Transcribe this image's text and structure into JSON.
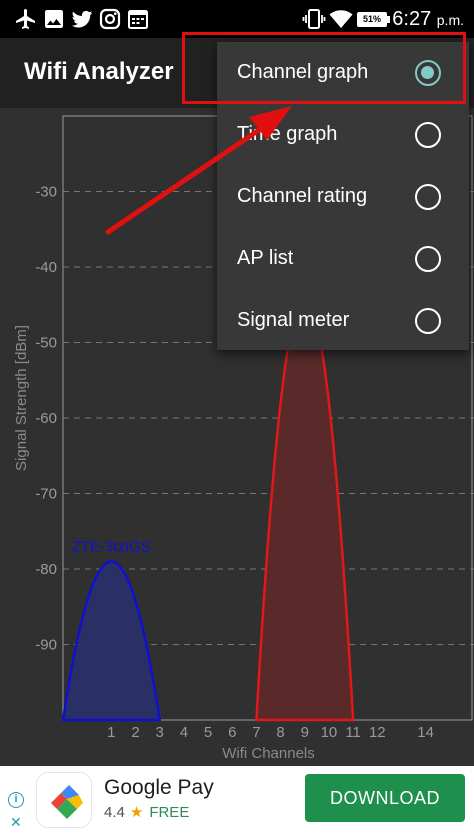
{
  "status_bar": {
    "time": "6:27",
    "ampm": "p.m.",
    "battery": "51%",
    "icons": [
      "airplane-icon",
      "gallery-icon",
      "twitter-icon",
      "instagram-icon",
      "calendar-icon",
      "vibrate-icon",
      "wifi-icon",
      "battery-icon"
    ]
  },
  "toolbar": {
    "title": "Wifi Analyzer"
  },
  "menu": {
    "items": [
      {
        "label": "Channel graph",
        "checked": true
      },
      {
        "label": "Time graph",
        "checked": false
      },
      {
        "label": "Channel rating",
        "checked": false
      },
      {
        "label": "AP list",
        "checked": false
      },
      {
        "label": "Signal meter",
        "checked": false
      }
    ]
  },
  "chart_data": {
    "type": "area",
    "xlabel": "Wifi Channels",
    "ylabel": "Signal Strength [dBm]",
    "xticks": [
      "1",
      "2",
      "3",
      "4",
      "5",
      "6",
      "7",
      "8",
      "9",
      "10",
      "11",
      "12",
      "14"
    ],
    "yticks": [
      "-30",
      "-40",
      "-50",
      "-60",
      "-70",
      "-80",
      "-90"
    ],
    "xlim": [
      -1,
      16
    ],
    "ylim": [
      -100,
      -20
    ],
    "grid": true,
    "series": [
      {
        "name": "ZTE-3tztGS",
        "center_channel": 1,
        "signal_dbm": -79,
        "color": "#1010d0",
        "fill": "#2a2f66"
      },
      {
        "center_channel": 9,
        "signal_dbm": -44,
        "color": "#e01818",
        "fill": "#5a2a2a"
      }
    ]
  },
  "ad": {
    "app_name": "Google Pay",
    "rating": "4.4",
    "price": "FREE",
    "button": "DOWNLOAD"
  },
  "colors": {
    "accent": "#80cbc4",
    "annotation": "#e01010",
    "download_button": "#1f8f4e"
  }
}
